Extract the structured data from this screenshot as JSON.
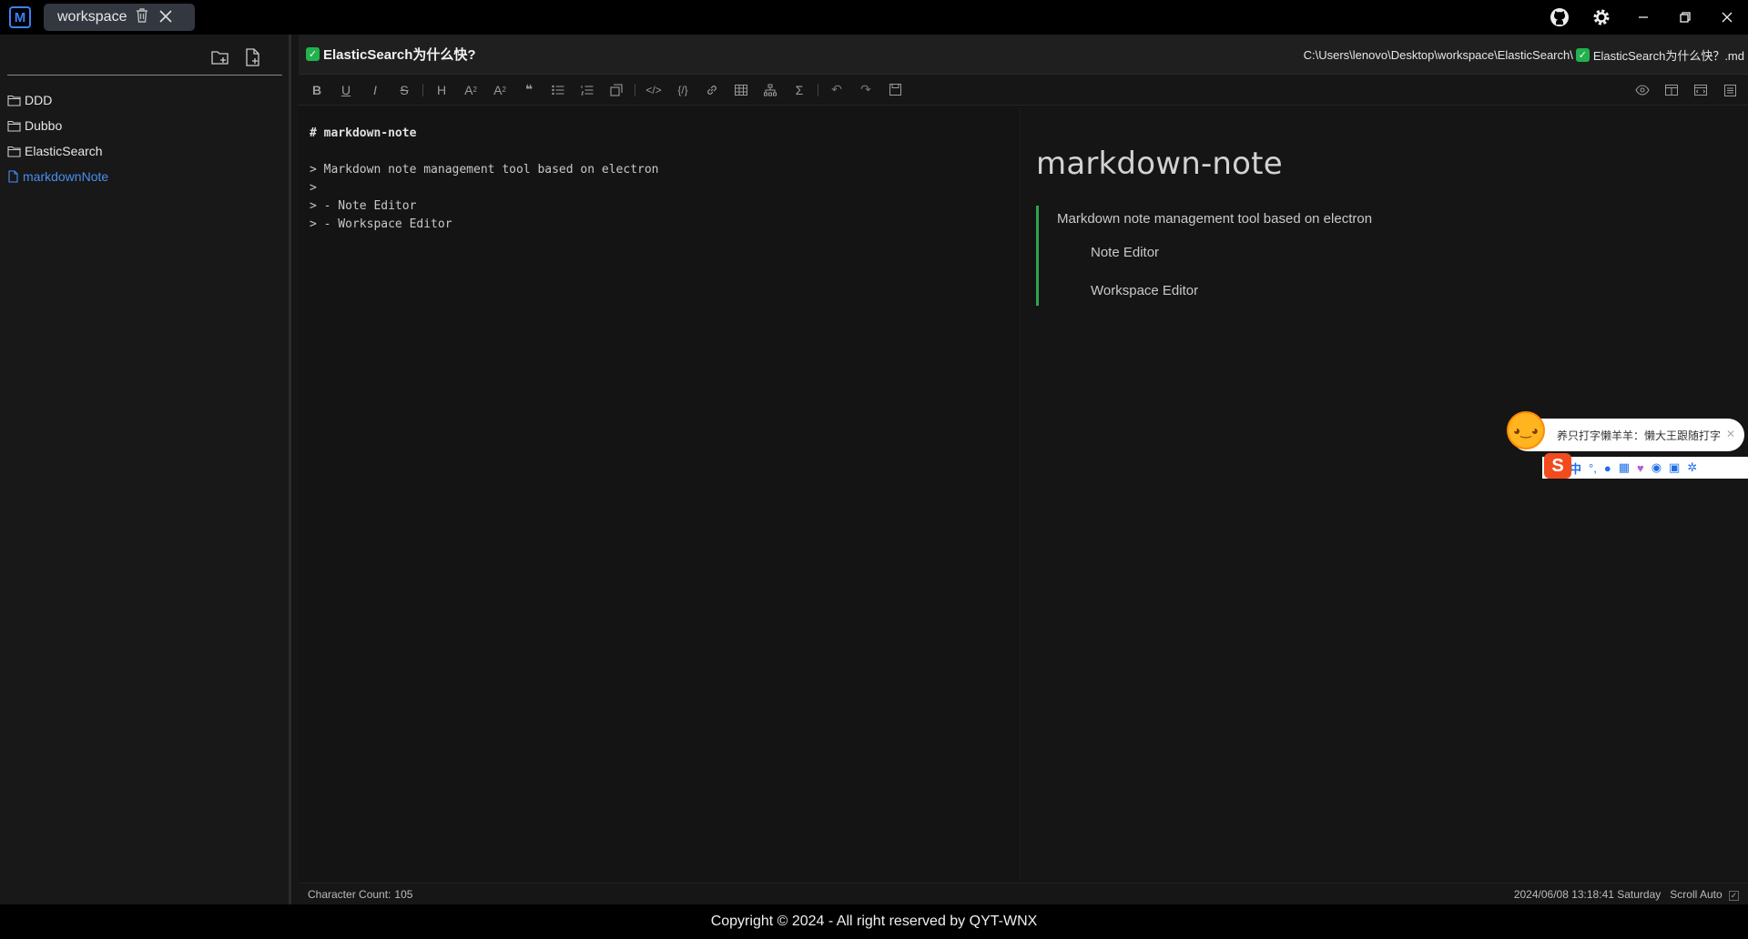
{
  "titlebar": {
    "app_logo": "M",
    "workspace_tab": "workspace",
    "icons": [
      "github-icon",
      "settings-icon",
      "minimize-icon",
      "restore-icon",
      "close-icon"
    ]
  },
  "sidebar": {
    "actions": [
      "new-folder-icon",
      "new-file-icon"
    ],
    "items": [
      {
        "label": "DDD",
        "type": "folder"
      },
      {
        "label": "Dubbo",
        "type": "folder"
      },
      {
        "label": "ElasticSearch",
        "type": "folder"
      },
      {
        "label": "markdownNote",
        "type": "file",
        "active": true
      }
    ]
  },
  "file": {
    "title": "ElasticSearch为什么快?",
    "path_prefix": "C:\\Users\\lenovo\\Desktop\\workspace\\ElasticSearch\\",
    "path_suffix": "ElasticSearch为什么快？.md"
  },
  "editor": {
    "lines": [
      "# markdown-note",
      "",
      "> Markdown note management tool based on electron",
      ">",
      "> - Note Editor",
      "> - Workspace Editor"
    ]
  },
  "preview": {
    "heading": "markdown-note",
    "quote_text": "Markdown note management tool based on electron",
    "list": [
      "Note Editor",
      "Workspace Editor"
    ]
  },
  "status": {
    "char_count_label": "Character Count:",
    "char_count": "105",
    "datetime": "2024/06/08 13:18:41 Saturday",
    "scroll_label": "Scroll Auto"
  },
  "footer": {
    "copyright": "Copyright © 2024 - All right reserved by QYT-WNX"
  },
  "ime": {
    "bubble_text": "养只打字懒羊羊：懒大王跟随打字",
    "mode_label": "中"
  },
  "colors": {
    "accent": "#4a8ef0",
    "quote_bar": "#2ea44f",
    "check": "#22b14c"
  }
}
